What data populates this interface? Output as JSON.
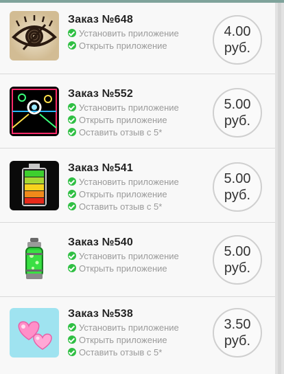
{
  "orders": [
    {
      "title": "Заказ №648",
      "tasks": [
        "Установить приложение",
        "Открыть приложение"
      ],
      "price": "4.00",
      "currency": "руб.",
      "icon": "eye-vinyl-icon"
    },
    {
      "title": "Заказ №552",
      "tasks": [
        "Установить приложение",
        "Открыть приложение",
        "Оставить отзыв с 5*"
      ],
      "price": "5.00",
      "currency": "руб.",
      "icon": "neon-air-hockey-icon"
    },
    {
      "title": "Заказ №541",
      "tasks": [
        "Установить приложение",
        "Открыть приложение",
        "Оставить отзыв с 5*"
      ],
      "price": "5.00",
      "currency": "руб.",
      "icon": "battery-icon"
    },
    {
      "title": "Заказ №540",
      "tasks": [
        "Установить приложение",
        "Открыть приложение"
      ],
      "price": "5.00",
      "currency": "руб.",
      "icon": "spray-can-icon"
    },
    {
      "title": "Заказ №538",
      "tasks": [
        "Установить приложение",
        "Открыть приложение",
        "Оставить отзыв с 5*"
      ],
      "price": "3.50",
      "currency": "руб.",
      "icon": "pink-hearts-icon"
    }
  ]
}
